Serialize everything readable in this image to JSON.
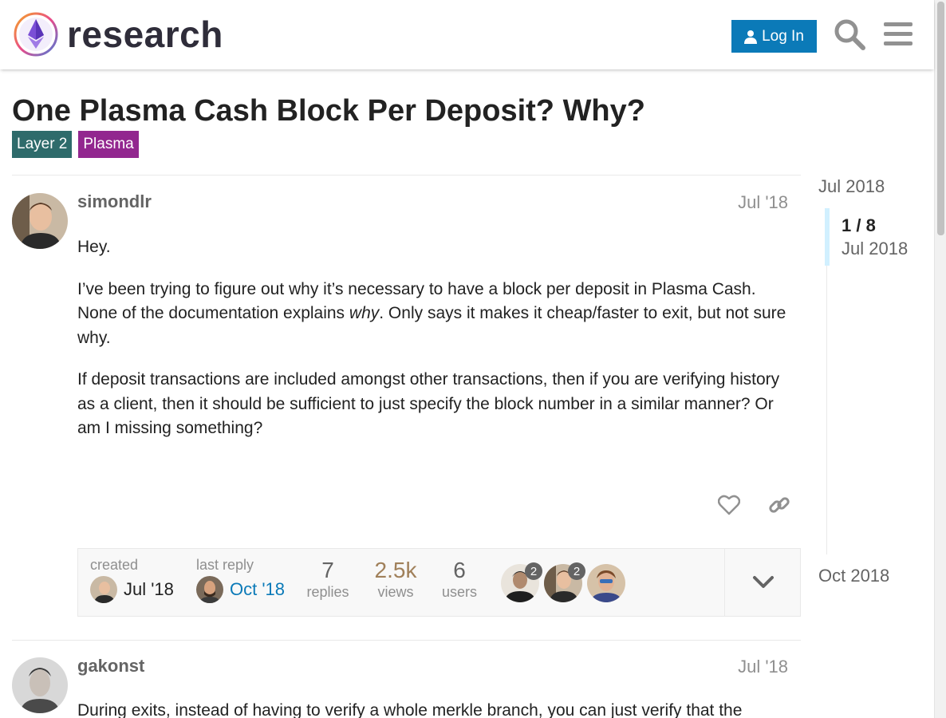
{
  "header": {
    "site_name": "research",
    "login_label": "Log In"
  },
  "topic": {
    "title": "One Plasma Cash Block Per Deposit? Why?",
    "tags": [
      {
        "label": "Layer 2",
        "color": "#2e6b6b"
      },
      {
        "label": "Plasma",
        "color": "#92278f"
      }
    ]
  },
  "posts": [
    {
      "username": "simondlr",
      "date": "Jul '18",
      "p1": "Hey.",
      "p2_before": "I’ve been trying to figure out why it’s necessary to have a block per deposit in Plasma Cash. None of the documentation explains ",
      "p2_em": "why",
      "p2_after": ". Only says it makes it cheap/faster to exit, but not sure why.",
      "p3": "If deposit transactions are included amongst other transactions, then if you are verifying history as a client, then it should be sufficient to just specify the block number in a similar manner? Or am I missing something?"
    },
    {
      "username": "gakonst",
      "date": "Jul '18",
      "p1": "During exits, instead of having to verify a whole merkle branch, you can just verify that the"
    }
  ],
  "topic_map": {
    "created_label": "created",
    "created_date": "Jul '18",
    "last_reply_label": "last reply",
    "last_reply_date": "Oct '18",
    "replies_count": "7",
    "replies_label": "replies",
    "views_count": "2.5k",
    "views_label": "views",
    "users_count": "6",
    "users_label": "users",
    "participant_counts": [
      "2",
      "2"
    ]
  },
  "timeline": {
    "start_label": "Jul 2018",
    "position": "1 / 8",
    "position_date": "Jul 2018",
    "end_label": "Oct 2018"
  },
  "colors": {
    "brand_blue": "#0b7ab8",
    "views_accent": "#a0805a"
  }
}
